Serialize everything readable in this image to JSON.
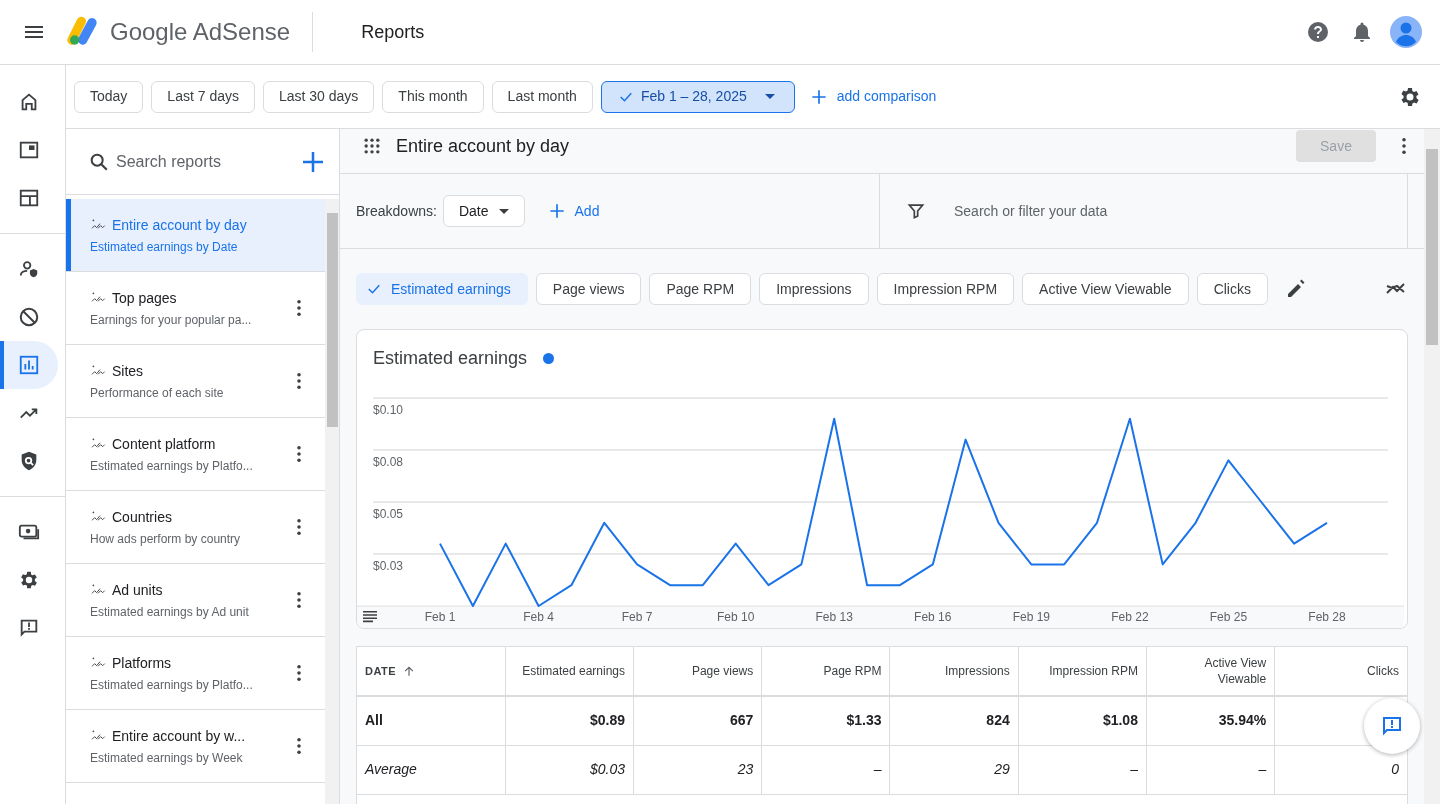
{
  "header": {
    "product": "Google AdSense",
    "page_title": "Reports"
  },
  "rail": [
    {
      "selected": false
    },
    {
      "selected": false
    },
    {
      "selected": false
    },
    {
      "selected": false
    },
    {
      "selected": false
    },
    {
      "selected": true
    },
    {
      "selected": false
    },
    {
      "selected": false
    },
    {
      "selected": false
    },
    {
      "selected": false
    },
    {
      "selected": false
    }
  ],
  "date_ranges": [
    {
      "label": "Today",
      "selected": false
    },
    {
      "label": "Last 7 days",
      "selected": false
    },
    {
      "label": "Last 30 days",
      "selected": false
    },
    {
      "label": "This month",
      "selected": false
    },
    {
      "label": "Last month",
      "selected": false
    },
    {
      "label": "Feb 1 – 28, 2025",
      "selected": true
    }
  ],
  "add_comparison": "add comparison",
  "reports": {
    "search_placeholder": "Search reports",
    "items": [
      {
        "title": "Entire account by day",
        "subtitle": "Estimated earnings by Date",
        "selected": true
      },
      {
        "title": "Top pages",
        "subtitle": "Earnings for your popular pa...",
        "selected": false
      },
      {
        "title": "Sites",
        "subtitle": "Performance of each site",
        "selected": false
      },
      {
        "title": "Content platform",
        "subtitle": "Estimated earnings by Platfo...",
        "selected": false
      },
      {
        "title": "Countries",
        "subtitle": "How ads perform by country",
        "selected": false
      },
      {
        "title": "Ad units",
        "subtitle": "Estimated earnings by Ad unit",
        "selected": false
      },
      {
        "title": "Platforms",
        "subtitle": "Estimated earnings by Platfo...",
        "selected": false
      },
      {
        "title": "Entire account by w...",
        "subtitle": "Estimated earnings by Week",
        "selected": false
      }
    ]
  },
  "report": {
    "title": "Entire account by day",
    "save": {
      "label": "Save",
      "disabled": true
    },
    "breakdowns_label": "Breakdowns:",
    "breakdown": "Date",
    "add": "Add",
    "filter_placeholder": "Search or filter your data"
  },
  "metrics": [
    {
      "label": "Estimated earnings",
      "selected": true
    },
    {
      "label": "Page views",
      "selected": false
    },
    {
      "label": "Page RPM",
      "selected": false
    },
    {
      "label": "Impressions",
      "selected": false
    },
    {
      "label": "Impression RPM",
      "selected": false
    },
    {
      "label": "Active View Viewable",
      "selected": false
    },
    {
      "label": "Clicks",
      "selected": false
    }
  ],
  "chart": {
    "title": "Estimated earnings",
    "color": "#1a73e8",
    "chart_data": {
      "type": "line",
      "categories": [
        "Feb 1",
        null,
        null,
        "Feb 4",
        null,
        null,
        "Feb 7",
        null,
        null,
        "Feb 10",
        null,
        null,
        "Feb 13",
        null,
        null,
        "Feb 16",
        null,
        null,
        "Feb 19",
        null,
        null,
        "Feb 22",
        null,
        null,
        "Feb 25",
        null,
        null,
        "Feb 28"
      ],
      "series": [
        {
          "color": "#1a73e8",
          "values": [
            0.03,
            0,
            0.03,
            0,
            0.01,
            0.04,
            0.02,
            0.01,
            0.01,
            0.03,
            0.01,
            0.02,
            0.09,
            0.01,
            0.01,
            0.02,
            0.08,
            0.04,
            0.02,
            0.02,
            0.04,
            0.09,
            0.02,
            0.04,
            0.07,
            0.05,
            0.03,
            0.04
          ]
        }
      ],
      "ylim": [
        0,
        0.1
      ],
      "grid": true,
      "yticks": [
        {
          "value": 0.025,
          "label": "$0.03"
        },
        {
          "value": 0.05,
          "label": "$0.05"
        },
        {
          "value": 0.075,
          "label": "$0.08"
        },
        {
          "value": 0.1,
          "label": "$0.10"
        }
      ]
    }
  },
  "table": {
    "columns": [
      {
        "label": "DATE",
        "sorted": true
      },
      {
        "label": "Estimated earnings",
        "sorted": false
      },
      {
        "label": "Page views",
        "sorted": false
      },
      {
        "label": "Page RPM",
        "sorted": false
      },
      {
        "label": "Impressions",
        "sorted": false
      },
      {
        "label": "Impression RPM",
        "sorted": false
      },
      {
        "label": "Active View Viewable",
        "sorted": false
      },
      {
        "label": "Clicks",
        "sorted": false
      }
    ],
    "rows": [
      {
        "kind": "total",
        "cells": [
          "All",
          "$0.89",
          "667",
          "$1.33",
          "824",
          "$1.08",
          "35.94%"
        ]
      },
      {
        "kind": "average",
        "cells": [
          "Average",
          "$0.03",
          "23",
          "–",
          "29",
          "–",
          "–",
          "0"
        ]
      }
    ]
  }
}
